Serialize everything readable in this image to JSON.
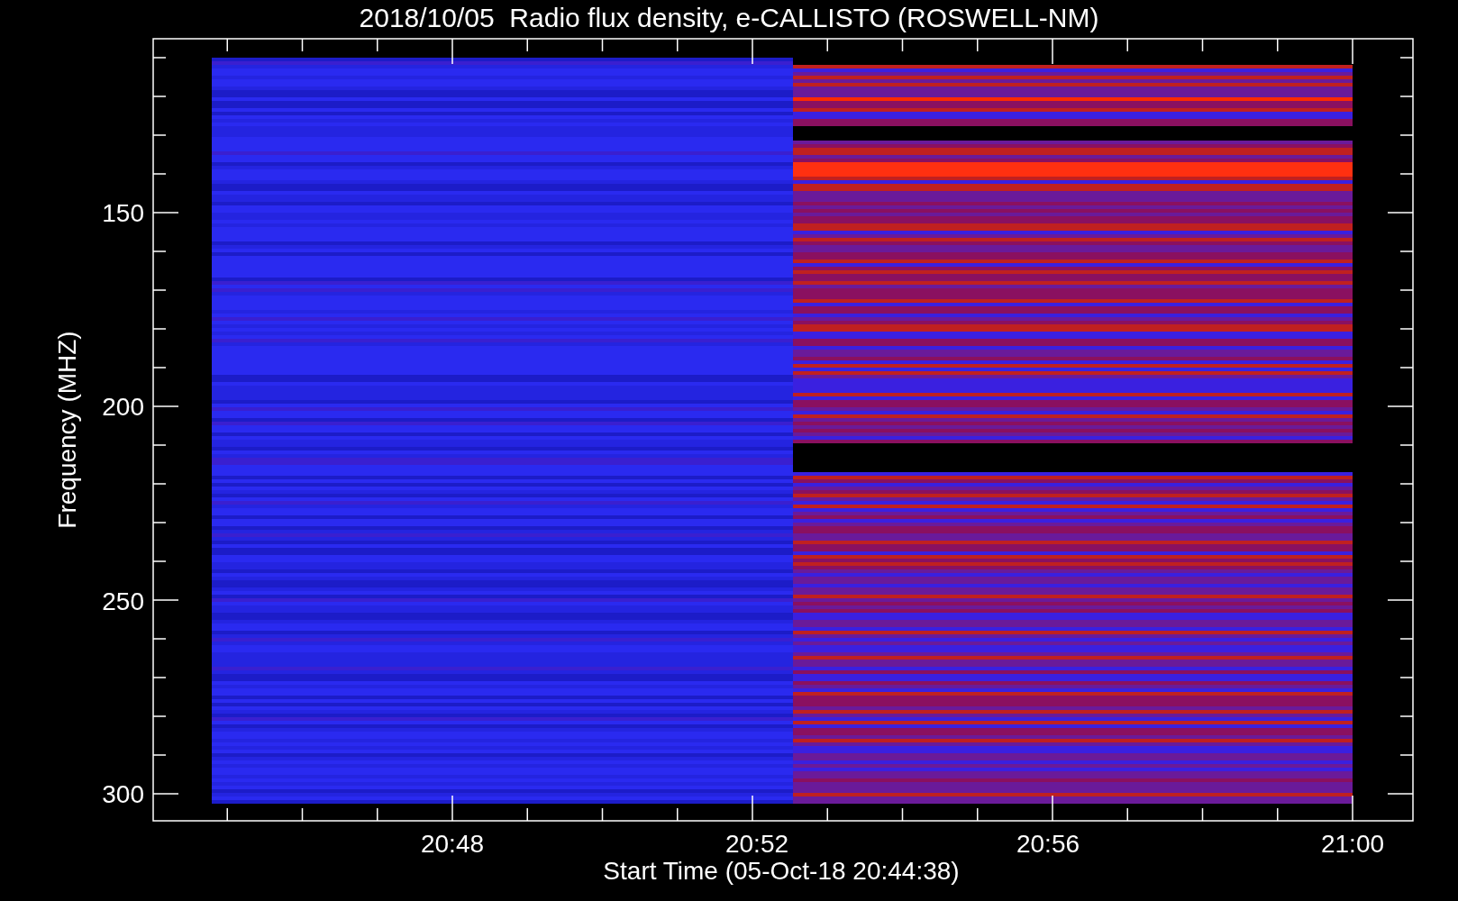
{
  "title": "2018/10/05  Radio flux density, e-CALLISTO (ROSWELL-NM)",
  "y_axis": {
    "label": "Frequency (MHZ)",
    "ticks": [
      "150",
      "200",
      "250",
      "300"
    ]
  },
  "x_axis": {
    "label": "Start Time (05-Oct-18 20:44:38)",
    "ticks": [
      "20:48",
      "20:52",
      "20:56",
      "21:00"
    ]
  }
}
